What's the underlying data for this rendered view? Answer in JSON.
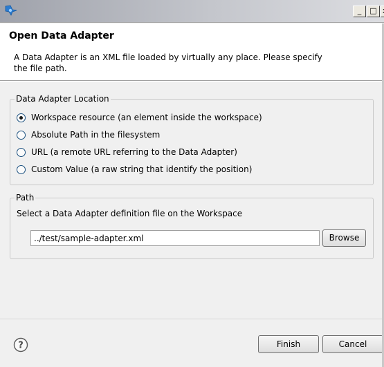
{
  "window": {
    "title_icon": "eclipse-app-icon",
    "controls": {
      "minimize": "_",
      "maximize": "□",
      "close": "x"
    }
  },
  "header": {
    "title": "Open Data Adapter",
    "description": "A Data Adapter is an XML file loaded by virtually any place. Please specify the file path."
  },
  "location_group": {
    "legend": "Data Adapter Location",
    "selected_index": 0,
    "options": [
      {
        "label": "Workspace resource (an element inside the workspace)",
        "checked": true
      },
      {
        "label": "Absolute Path in the filesystem",
        "checked": false
      },
      {
        "label": "URL (a remote URL referring to the Data Adapter)",
        "checked": false
      },
      {
        "label": "Custom Value (a raw string that identify the position)",
        "checked": false
      }
    ]
  },
  "path_group": {
    "legend": "Path",
    "description": "Select a Data Adapter definition file on the Workspace",
    "value": "../test/sample-adapter.xml",
    "browse_label": "Browse"
  },
  "footer": {
    "help_icon": "help-question-icon",
    "finish_label": "Finish",
    "cancel_label": "Cancel"
  }
}
